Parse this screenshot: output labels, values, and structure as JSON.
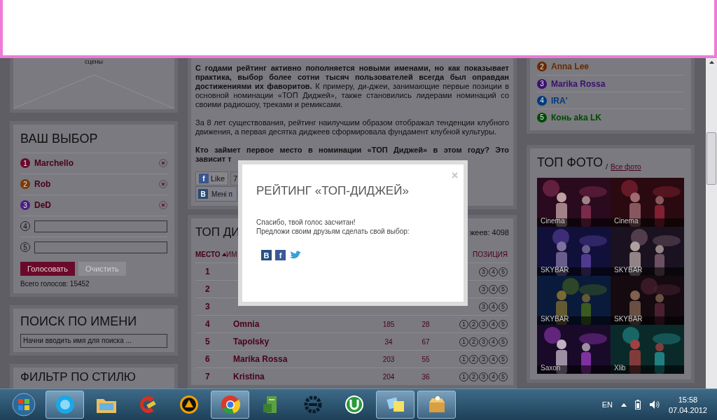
{
  "left": {
    "top_panel": {
      "caption": "сцены"
    },
    "your_choice": {
      "title": "ВАШ ВЫБОР",
      "picks": [
        {
          "number": "1",
          "name": "Marchello",
          "color": "#6a0a2a"
        },
        {
          "number": "2",
          "name": "Rob",
          "color": "#7a3a08"
        },
        {
          "number": "3",
          "name": "DeD",
          "color": "#4a2080"
        }
      ],
      "empty_slots": [
        {
          "number": "4"
        },
        {
          "number": "5"
        }
      ],
      "buttons": [
        {
          "label": "Голосовать",
          "disabled": false
        },
        {
          "label": "Очистить",
          "disabled": true
        }
      ],
      "total": "Всего голосов: 15452"
    },
    "name_search": {
      "title": "ПОИСК ПО ИМЕНИ",
      "placeholder": "Начни вводить имя для поиска ..."
    },
    "style_filter": {
      "title": "ФИЛЬТР ПО СТИЛЮ"
    }
  },
  "article": {
    "paragraphs": [
      {
        "text": "**С годами рейтинг активно пополняется новыми именами, но как показывает практика, выбор более сотни тысяч пользователей всегда был оправдан достижениями их фаворитов.** К примеру, ди-джеи, занимающие первые позиции в основной номинации «ТОП Диджей», также становились лидерами номинаций со своими радиошоу, треками и ремиксами.",
        "bold": false
      },
      {
        "text": "За 8 лет существования, рейтинг наилучшим образом отображал тенденции клубного движения, а первая десятка диджеев сформировала фундамент клубной культуры.",
        "bold": false
      },
      {
        "lines": [
          "Кто займет первое место в номинации «ТОП Диджей» в этом году? Это",
          "зависит т"
        ],
        "bold": true
      }
    ],
    "like": {
      "icon_letter": "f",
      "label": "Like",
      "count": "7"
    },
    "vk_share": {
      "icon_letter": "В",
      "label": "Мені п"
    }
  },
  "table": {
    "title": "ТОП ДИ",
    "summary": "жеев: 4098",
    "columns": [
      {
        "label": "МЕСТО",
        "sorted": true
      },
      {
        "label": "ИМ",
        "sorted": false
      },
      {
        "label": "ПОЗИЦИЯ",
        "sorted": false
      }
    ],
    "rows": [
      {
        "place": "1",
        "positions": [
          "3",
          "4",
          "5"
        ]
      },
      {
        "place": "2",
        "positions": [
          "3",
          "4",
          "5"
        ]
      },
      {
        "place": "3",
        "positions": [
          "3",
          "4",
          "5"
        ]
      },
      {
        "place": "4",
        "name": "Omnia",
        "column_3": "185",
        "column_4": "28",
        "positions": [
          "1",
          "2",
          "3",
          "4",
          "5"
        ]
      },
      {
        "place": "5",
        "name": "Tapolsky",
        "column_3": "34",
        "column_4": "67",
        "positions": [
          "1",
          "2",
          "3",
          "4",
          "5"
        ]
      },
      {
        "place": "6",
        "name": "Marika Rossa",
        "column_3": "203",
        "column_4": "55",
        "positions": [
          "1",
          "2",
          "3",
          "4",
          "5"
        ]
      },
      {
        "place": "7",
        "name": "Kristina",
        "column_3": "204",
        "column_4": "36",
        "positions": [
          "1",
          "2",
          "3",
          "4",
          "5"
        ]
      }
    ]
  },
  "right": {
    "ranking": [
      {
        "number": "2",
        "name": "Anna Lee",
        "color": "#6a2a00"
      },
      {
        "number": "3",
        "name": "Marika Rossa",
        "color": "#3a1070"
      },
      {
        "number": "4",
        "name": "IRA'",
        "color": "#003a80"
      },
      {
        "number": "5",
        "name": "Конь aka LK",
        "color": "#004a00"
      }
    ],
    "top_photos": {
      "title": "ТОП ФОТО",
      "separator": "/",
      "link": "Все фото",
      "photos": [
        {
          "label": "Cinema"
        },
        {
          "label": "Cinema"
        },
        {
          "label": "SKYBAR"
        },
        {
          "label": "SKYBAR"
        },
        {
          "label": "SKYBAR"
        },
        {
          "label": "SKYBAR"
        },
        {
          "label": "Saxon"
        },
        {
          "label": "Xlib"
        }
      ]
    }
  },
  "modal": {
    "title": "РЕЙТИНГ «ТОП-ДИДЖЕЙ»",
    "message": "Спасибо, твой голос засчитан!",
    "prompt": "Предложи своим друзьям сделать свой выбор:",
    "share": [
      {
        "kind": "vk",
        "letter": "В"
      },
      {
        "kind": "facebook",
        "letter": "f"
      },
      {
        "kind": "twitter"
      }
    ]
  },
  "taskbar": {
    "apps": [
      {
        "kind": "chat",
        "open": true
      },
      {
        "kind": "folder",
        "open": false
      },
      {
        "kind": "cleaner",
        "open": false
      },
      {
        "kind": "player",
        "open": false
      },
      {
        "kind": "browser",
        "open": true
      },
      {
        "kind": "server",
        "open": false
      },
      {
        "kind": "gear",
        "open": false
      },
      {
        "kind": "torrent",
        "open": false
      },
      {
        "kind": "notes",
        "open": true
      },
      {
        "kind": "archive",
        "open": true
      }
    ],
    "language": "EN",
    "time": "15:58",
    "date": "07.04.2012"
  }
}
